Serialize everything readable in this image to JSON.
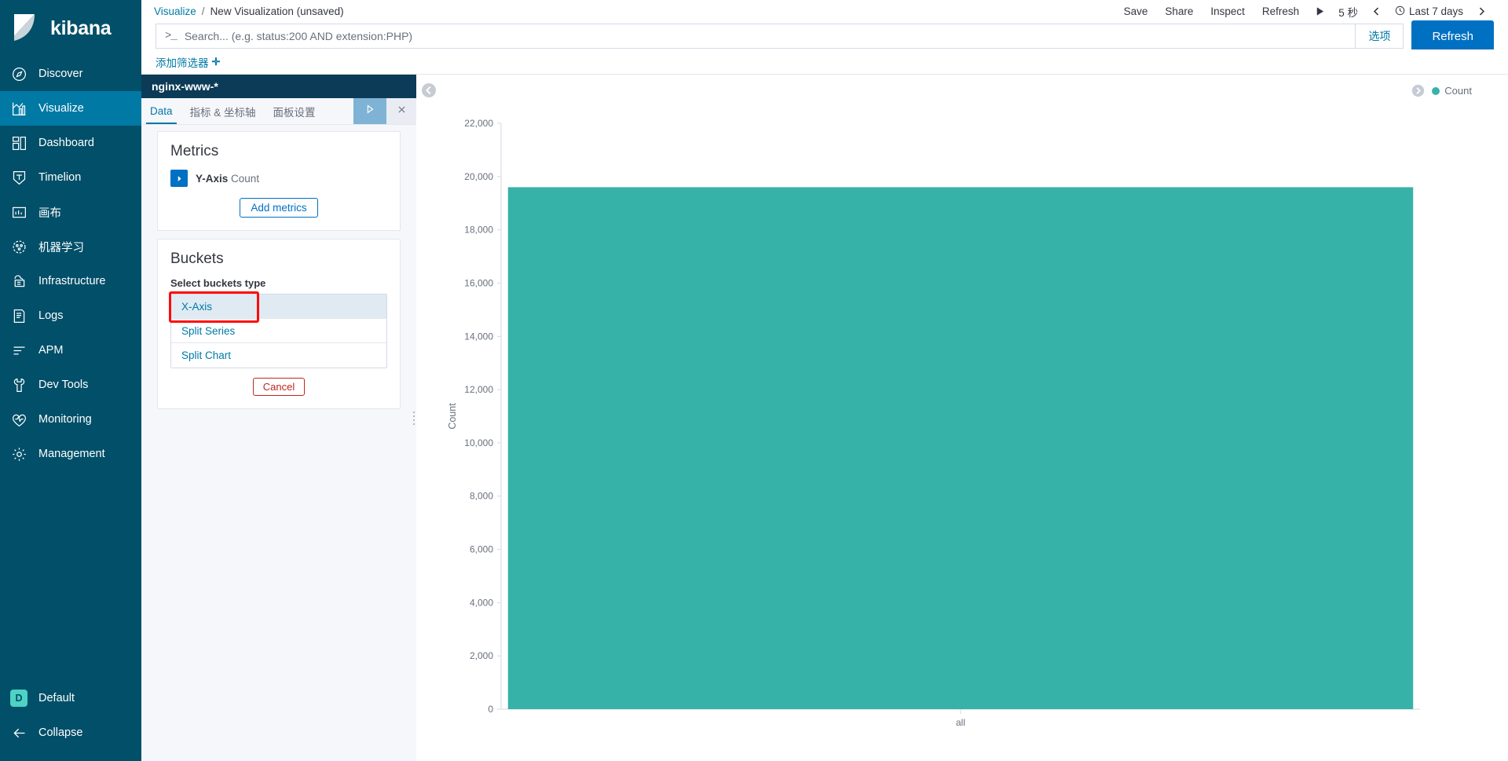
{
  "brand": {
    "name": "kibana"
  },
  "sidebar": {
    "items": [
      {
        "label": "Discover",
        "icon": "compass-icon",
        "active": false
      },
      {
        "label": "Visualize",
        "icon": "visualize-bar-icon",
        "active": true
      },
      {
        "label": "Dashboard",
        "icon": "dashboard-grid-icon",
        "active": false
      },
      {
        "label": "Timelion",
        "icon": "timelion-icon",
        "active": false
      },
      {
        "label": "画布",
        "icon": "canvas-icon",
        "active": false
      },
      {
        "label": "机器学习",
        "icon": "machine-learning-icon",
        "active": false
      },
      {
        "label": "Infrastructure",
        "icon": "infrastructure-icon",
        "active": false
      },
      {
        "label": "Logs",
        "icon": "logs-icon",
        "active": false
      },
      {
        "label": "APM",
        "icon": "apm-icon",
        "active": false
      },
      {
        "label": "Dev Tools",
        "icon": "wrench-icon",
        "active": false
      },
      {
        "label": "Monitoring",
        "icon": "heartbeat-icon",
        "active": false
      },
      {
        "label": "Management",
        "icon": "gear-icon",
        "active": false
      }
    ],
    "space": {
      "badge": "D",
      "label": "Default"
    },
    "collapse": {
      "label": "Collapse",
      "icon": "arrow-left-icon"
    }
  },
  "topbar": {
    "breadcrumb": {
      "root": "Visualize",
      "separator": "/",
      "current": "New Visualization (unsaved)"
    },
    "save_label": "Save",
    "share_label": "Share",
    "inspect_label": "Inspect",
    "refresh_label": "Refresh",
    "play_icon": "play-icon",
    "interval_label": "5 秒",
    "prev_icon": "chevron-left-icon",
    "clock_icon": "clock-icon",
    "time_range": "Last 7 days",
    "next_icon": "chevron-right-icon"
  },
  "query": {
    "prompt": ">_",
    "value": "",
    "placeholder": "Search... (e.g. status:200 AND extension:PHP)",
    "options_label": "选项",
    "refresh_label": "Refresh"
  },
  "filters": {
    "add_label": "添加筛选器",
    "plus": "✛"
  },
  "editor": {
    "index_pattern": "nginx-www-*",
    "tabs": [
      {
        "label": "Data",
        "active": true
      },
      {
        "label": "指标 & 坐标轴",
        "active": false
      },
      {
        "label": "面板设置",
        "active": false
      }
    ],
    "apply_icon": "play-triangle-icon",
    "discard_icon": "close-x-icon",
    "metrics": {
      "title": "Metrics",
      "rows": [
        {
          "axis": "Y-Axis",
          "agg": "Count",
          "toggle_icon": "chevron-right-icon"
        }
      ],
      "add_label": "Add metrics"
    },
    "buckets": {
      "title": "Buckets",
      "select_label": "Select buckets type",
      "options": [
        {
          "label": "X-Axis",
          "selected": true,
          "highlighted": true
        },
        {
          "label": "Split Series",
          "selected": false,
          "highlighted": false
        },
        {
          "label": "Split Chart",
          "selected": false,
          "highlighted": false
        }
      ],
      "cancel_label": "Cancel"
    }
  },
  "visualization": {
    "collapse_icon": "chevron-left-circle-icon",
    "legend_toggle_icon": "chevron-right-circle-icon",
    "legend": [
      {
        "label": "Count",
        "color": "#37b2a8"
      }
    ]
  },
  "chart_data": {
    "type": "bar",
    "title": "",
    "categories": [
      "all"
    ],
    "values": [
      19600
    ],
    "series": [
      {
        "name": "Count",
        "color": "#37b2a8",
        "values": [
          19600
        ]
      }
    ],
    "xlabel": "all",
    "ylabel": "Count",
    "ylim": [
      0,
      22000
    ],
    "yticks": [
      0,
      2000,
      4000,
      6000,
      8000,
      10000,
      12000,
      14000,
      16000,
      18000,
      20000,
      22000
    ],
    "ytick_labels": [
      "0",
      "2,000",
      "4,000",
      "6,000",
      "8,000",
      "10,000",
      "12,000",
      "14,000",
      "16,000",
      "18,000",
      "20,000",
      "22,000"
    ],
    "xticks": [
      "all"
    ],
    "grid": false,
    "legend_position": "top-right"
  },
  "colors": {
    "sidebar_bg": "#014f69",
    "sidebar_active": "#0079a5",
    "accent_blue": "#0079a5",
    "primary_button": "#0071c2",
    "bar_teal": "#37b2a8",
    "danger_red": "#bd271e",
    "highlight_red": "#ff0a0a",
    "panel_header": "#0b3b57"
  }
}
